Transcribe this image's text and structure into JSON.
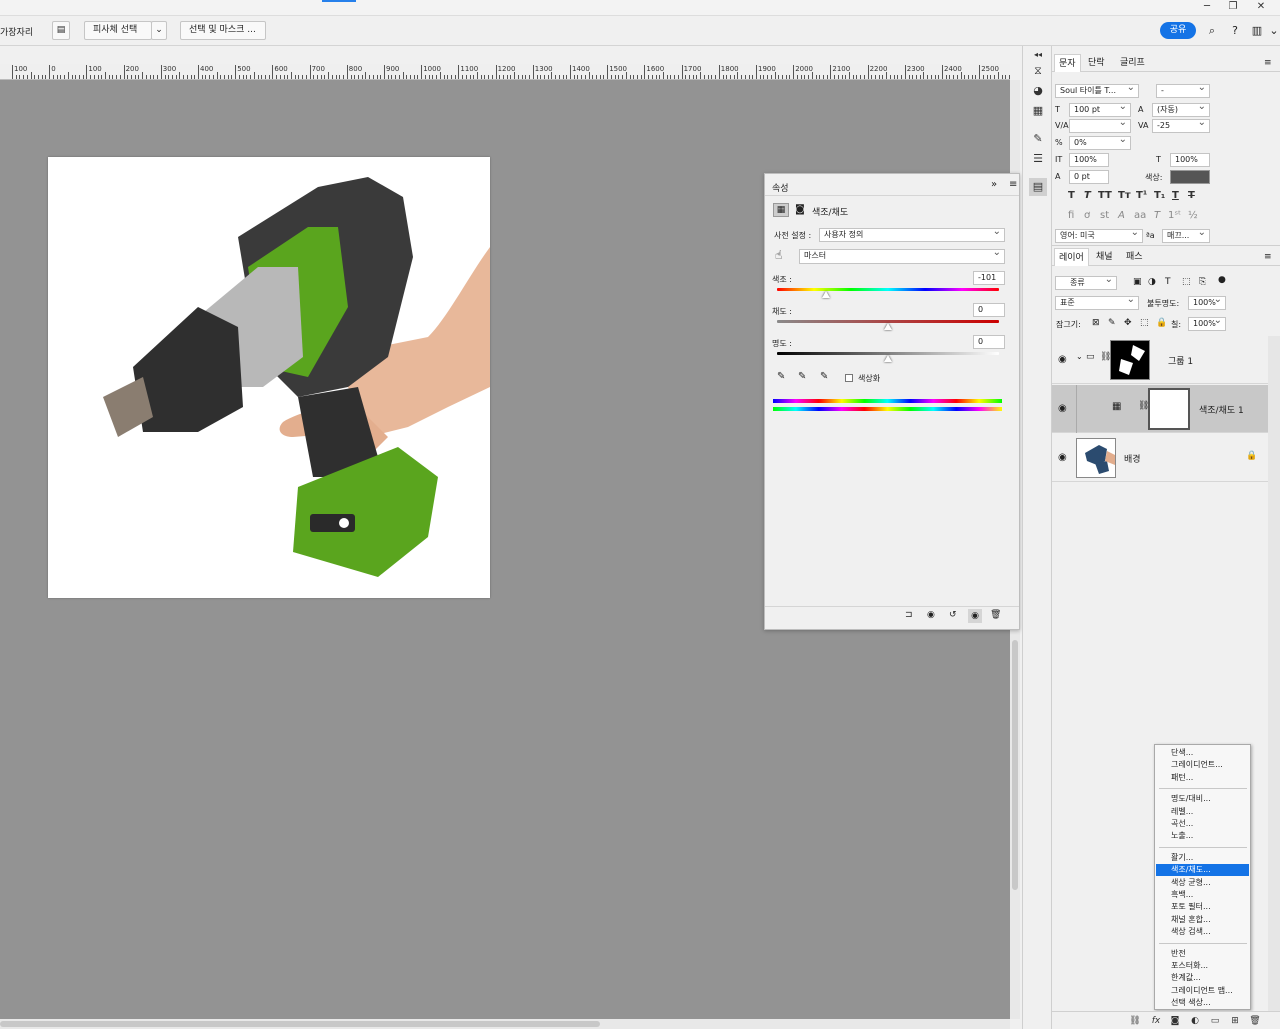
{
  "options_bar": {
    "workspace_label": "가장자리",
    "select_subject": "피사체 선택",
    "select_and_mask": "선택 및 마스크 ...",
    "share": "공유"
  },
  "ruler": {
    "labels": [
      "100",
      "0",
      "100",
      "200",
      "300",
      "400",
      "500",
      "600",
      "700",
      "800",
      "900",
      "1000",
      "1100",
      "1200",
      "1300",
      "1400",
      "1500",
      "1600",
      "1700",
      "1800",
      "1900",
      "2000",
      "2100",
      "2200",
      "2300",
      "2400",
      "2500"
    ]
  },
  "properties": {
    "tab": "속성",
    "title": "색조/채도",
    "preset_label": "사전 설정 :",
    "preset_value": "사용자 정의",
    "channel": "마스터",
    "hue_label": "색조 :",
    "hue_value": "-101",
    "hue_level": 0.22,
    "sat_label": "채도 :",
    "sat_value": "0",
    "sat_level": 0.5,
    "light_label": "명도 :",
    "light_value": "0",
    "light_level": 0.5,
    "colorize": "색상화"
  },
  "character": {
    "tabs": [
      "문자",
      "단락",
      "글리프"
    ],
    "font_family": "Soul 타이틀 T...",
    "font_style": "-",
    "size": "100 pt",
    "leading": "(자동)",
    "kerning": "",
    "tracking": "-25",
    "scale_pct": "0%",
    "vscale": "100%",
    "hscale": "100%",
    "baseline": "0 pt",
    "color_label": "색상:",
    "language": "영어: 미국",
    "aa": "매끄...",
    "color_swatch": "#555555"
  },
  "layers": {
    "tabs": [
      "레이어",
      "채널",
      "패스"
    ],
    "filter": "종류",
    "blend": "표준",
    "opacity_label": "불투명도:",
    "opacity": "100%",
    "lock_label": "잠그기:",
    "fill_label": "칠:",
    "fill": "100%",
    "rows": [
      {
        "name": "그룹 1"
      },
      {
        "name": "색조/채도 1"
      },
      {
        "name": "배경"
      }
    ]
  },
  "menu": {
    "groups": [
      [
        "단색...",
        "그레이디언트...",
        "패턴..."
      ],
      [
        "명도/대비...",
        "레벨...",
        "곡선...",
        "노출..."
      ],
      [
        "활기...",
        "색조/채도...",
        "색상 균형...",
        "흑백...",
        "포토 필터...",
        "채널 혼합...",
        "색상 검색..."
      ],
      [
        "반전",
        "포스터화...",
        "한계값...",
        "그레이디언트 맵...",
        "선택 색상..."
      ]
    ],
    "selected": "색조/채도..."
  },
  "colors": {
    "accent": "#1473e6",
    "canvas": "#939393",
    "tool_green": "#5aa51e"
  }
}
